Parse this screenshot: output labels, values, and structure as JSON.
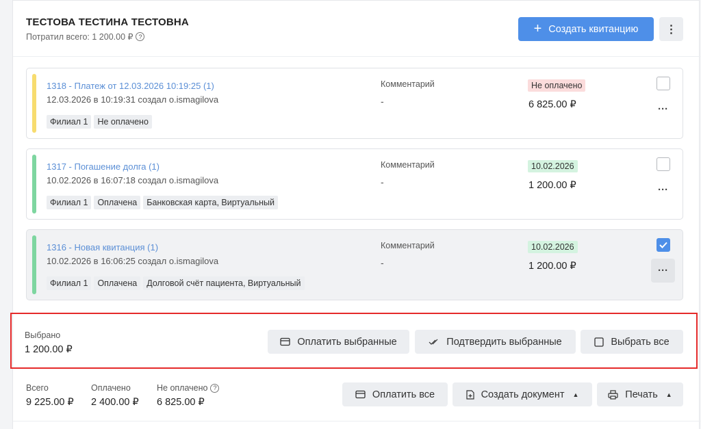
{
  "header": {
    "title": "ТЕСТОВА ТЕСТИНА ТЕСТОВНА",
    "subtitle": "Потратил всего: 1 200.00 ₽",
    "create_button": "Создать квитанцию"
  },
  "receipts": [
    {
      "title": "1318 - Платеж от 12.03.2026 10:19:25 (1)",
      "meta": "12.03.2026 в 10:19:31 создал o.ismagilova",
      "tags": [
        "Филиал 1",
        "Не оплачено"
      ],
      "comment_label": "Комментарий",
      "comment": "-",
      "status": "Не оплачено",
      "amount": "6 825.00 ₽",
      "stripe_color": "#f7dc6f",
      "checked": false
    },
    {
      "title": "1317 - Погашение долга (1)",
      "meta": "10.02.2026 в 16:07:18 создал o.ismagilova",
      "tags": [
        "Филиал 1",
        "Оплачена",
        "Банковская карта, Виртуальный"
      ],
      "comment_label": "Комментарий",
      "comment": "-",
      "status": "10.02.2026",
      "amount": "1 200.00 ₽",
      "stripe_color": "#7ed6a0",
      "checked": false
    },
    {
      "title": "1316 - Новая квитанция (1)",
      "meta": "10.02.2026 в 16:06:25 создал o.ismagilova",
      "tags": [
        "Филиал 1",
        "Оплачена",
        "Долговой счёт пациента, Виртуальный"
      ],
      "comment_label": "Комментарий",
      "comment": "-",
      "status": "10.02.2026",
      "amount": "1 200.00 ₽",
      "stripe_color": "#7ed6a0",
      "checked": true
    }
  ],
  "selection": {
    "label": "Выбрано",
    "value": "1 200.00 ₽",
    "pay_selected": "Оплатить выбранные",
    "confirm_selected": "Подтвердить выбранные",
    "select_all": "Выбрать все"
  },
  "totals": {
    "total_label": "Всего",
    "total_value": "9 225.00 ₽",
    "paid_label": "Оплачено",
    "paid_value": "2 400.00 ₽",
    "unpaid_label": "Не оплачено",
    "unpaid_value": "6 825.00 ₽",
    "pay_all": "Оплатить все",
    "create_doc": "Создать документ",
    "print": "Печать"
  },
  "colors": {
    "accent": "#4e8fe8",
    "highlight_border": "#e52a2a"
  }
}
